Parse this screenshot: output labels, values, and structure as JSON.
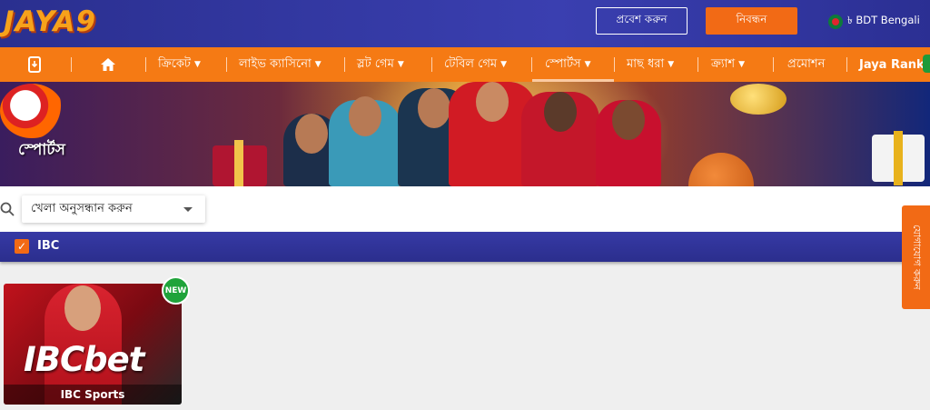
{
  "header": {
    "logo_text": "JAYA9",
    "login_label": "প্রবেশ করুন",
    "register_label": "নিবন্ধন",
    "currency_lang": "৳ BDT Bengali"
  },
  "nav": {
    "items": [
      {
        "label": "ক্রিকেট"
      },
      {
        "label": "লাইভ ক্যাসিনো"
      },
      {
        "label": "স্লট গেম"
      },
      {
        "label": "টেবিল গেম"
      },
      {
        "label": "স্পোর্টস"
      },
      {
        "label": "মাছ ধরা"
      },
      {
        "label": "ক্র্যাশ"
      },
      {
        "label": "প্রমোশন"
      },
      {
        "label": "Jaya Rank"
      }
    ],
    "active": "স্পোর্টস"
  },
  "banner": {
    "title": "স্পোর্টস"
  },
  "search": {
    "placeholder": "খেলা অনুসন্ধান করুন"
  },
  "filter": {
    "label": "IBC",
    "checked": true
  },
  "contact_tab": {
    "label": "যোগাযোগ করুন"
  },
  "games": [
    {
      "logo": "IBCbet",
      "caption": "IBC Sports",
      "badge": "NEW"
    }
  ],
  "colors": {
    "header_bg": "#2e329a",
    "nav_bg": "#f57a14",
    "accent": "#f26a15",
    "badge_green": "#1fa33a"
  }
}
